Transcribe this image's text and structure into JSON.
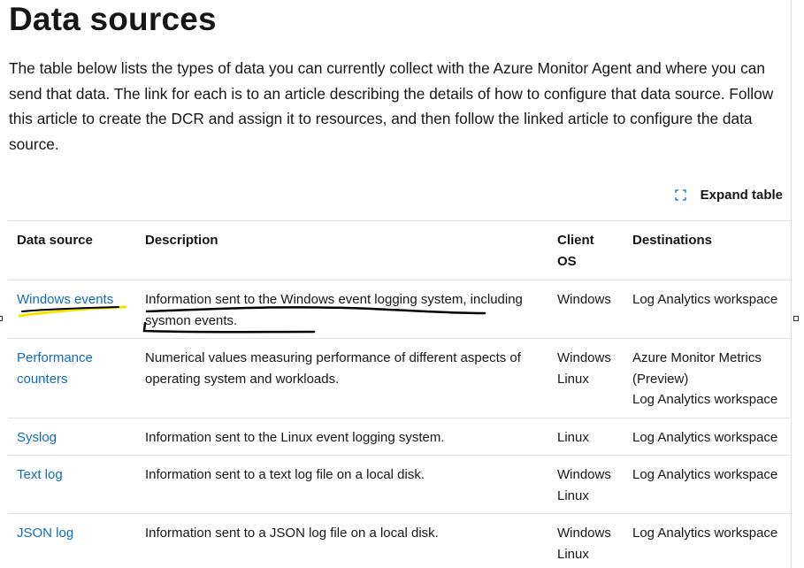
{
  "page": {
    "title": "Data sources",
    "intro": "The table below lists the types of data you can currently collect with the Azure Monitor Agent and where you can send that data. The link for each is to an article describing the details of how to configure that data source. Follow this article to create the DCR and assign it to resources, and then follow the linked article to configure the data source."
  },
  "toolbar": {
    "expand_label": "Expand table"
  },
  "table": {
    "headers": {
      "source": "Data source",
      "description": "Description",
      "os_line1": "Client",
      "os_line2": "OS",
      "destinations": "Destinations"
    },
    "rows": [
      {
        "source": "Windows events",
        "description": "Information sent to the Windows event logging system, including sysmon events.",
        "os": [
          "Windows"
        ],
        "destinations": [
          "Log Analytics workspace"
        ]
      },
      {
        "source": "Performance counters",
        "description": "Numerical values measuring performance of different aspects of operating system and workloads.",
        "os": [
          "Windows",
          "Linux"
        ],
        "destinations": [
          "Azure Monitor Metrics (Preview)",
          "Log Analytics workspace"
        ]
      },
      {
        "source": "Syslog",
        "description": "Information sent to the Linux event logging system.",
        "os": [
          "Linux"
        ],
        "destinations": [
          "Log Analytics workspace"
        ]
      },
      {
        "source": "Text log",
        "description": "Information sent to a text log file on a local disk.",
        "os": [
          "Windows",
          "Linux"
        ],
        "destinations": [
          "Log Analytics workspace"
        ]
      },
      {
        "source": "JSON log",
        "description": "Information sent to a JSON log file on a local disk.",
        "os": [
          "Windows",
          "Linux"
        ],
        "destinations": [
          "Log Analytics workspace"
        ]
      }
    ]
  },
  "colors": {
    "link": "#0f6cbd",
    "text": "#161616",
    "border": "#e1e1e1",
    "highlight_yellow": "#f2e600",
    "ink_black": "#000000"
  }
}
